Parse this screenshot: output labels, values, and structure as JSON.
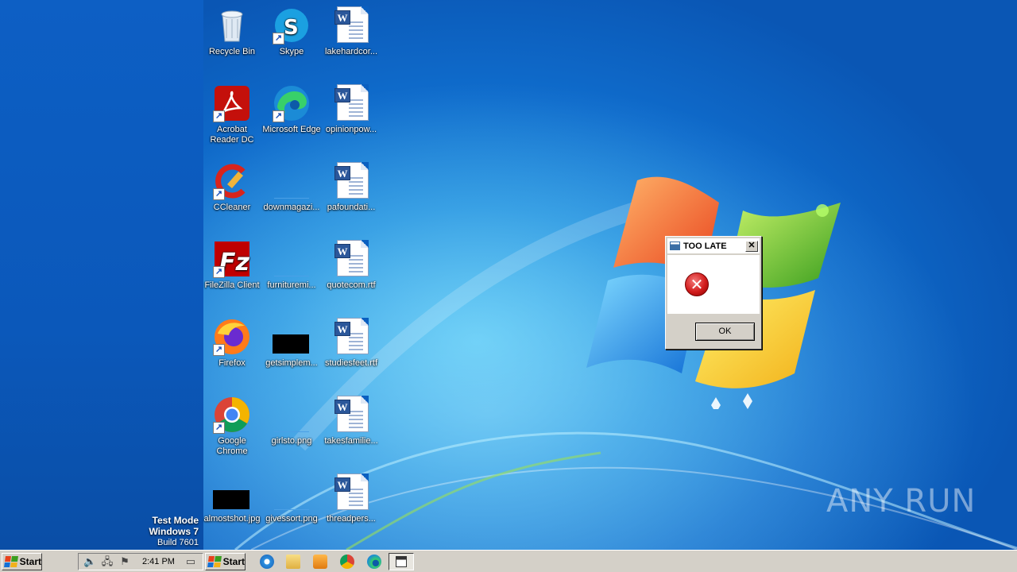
{
  "desktop": {
    "icons": [
      {
        "label": "Recycle Bin",
        "kind": "recycle-bin"
      },
      {
        "label": "Skype",
        "kind": "skype"
      },
      {
        "label": "lakehardcor...",
        "kind": "word-doc"
      },
      {
        "label": "Acrobat Reader DC",
        "kind": "acrobat"
      },
      {
        "label": "Microsoft Edge",
        "kind": "edge"
      },
      {
        "label": "opinionpow...",
        "kind": "word-doc"
      },
      {
        "label": "CCleaner",
        "kind": "ccleaner"
      },
      {
        "label": "downmagazi...",
        "kind": "blank-file"
      },
      {
        "label": "pafoundati...",
        "kind": "word-doc"
      },
      {
        "label": "FileZilla Client",
        "kind": "filezilla"
      },
      {
        "label": "furnituremi...",
        "kind": "blank-file"
      },
      {
        "label": "quotecom.rtf",
        "kind": "word-doc"
      },
      {
        "label": "Firefox",
        "kind": "firefox"
      },
      {
        "label": "getsimplem...",
        "kind": "black-image"
      },
      {
        "label": "studiesfeet.rtf",
        "kind": "word-doc"
      },
      {
        "label": "Google Chrome",
        "kind": "chrome"
      },
      {
        "label": "girlsto.png",
        "kind": "blank-file"
      },
      {
        "label": "takesfamilie...",
        "kind": "word-doc"
      },
      {
        "label": "almostshot.jpg",
        "kind": "black-image"
      },
      {
        "label": "givessort.png",
        "kind": "blank-file"
      },
      {
        "label": "threadpers...",
        "kind": "word-doc"
      }
    ],
    "test_mode": {
      "line1": "Test Mode",
      "line2": "Windows 7",
      "line3": "Build 7601"
    },
    "watermark": "ANY RUN"
  },
  "dialog": {
    "title": "TOO LATE",
    "close_label": "✕",
    "icon": "error-icon",
    "ok_label": "OK"
  },
  "taskbar": {
    "start_label": "Start",
    "start2_label": "Start",
    "clock": "2:41 PM",
    "tray_icons": [
      "speaker-icon",
      "network-icon",
      "flag-icon"
    ],
    "quick_launch": [
      "internet-explorer-icon",
      "folder-icon",
      "media-player-icon",
      "chrome-icon",
      "edge-icon",
      "active-window-icon"
    ]
  },
  "colors": {
    "desktop_blue": "#0f6ccc",
    "dialog_gray": "#d4d0c8",
    "error_red": "#d21c1c"
  }
}
